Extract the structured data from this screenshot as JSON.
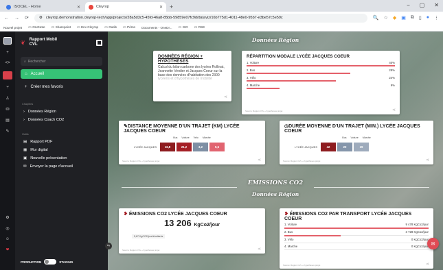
{
  "browser": {
    "tabs": [
      {
        "label": "ISOCEL - Home",
        "active": false,
        "color": "#3b78e7"
      },
      {
        "label": "Cleyrop",
        "active": true,
        "color": "#e8453c"
      }
    ],
    "url": "cleyrop.demonstration.cleyrop-tech/app/projects/28a5d3c5-45fd-46a8-85bb-59859e07fc9d/dataviz/16b775d1-4011-48e0-95b7-e3be57c5e59c",
    "bookmarks": [
      "Nouvel projet",
      "OneNote",
      "Sharepoint",
      "Env Cleyrop",
      "Outils",
      "Pérso",
      "Documents - OneDr...",
      "ISO",
      "RSE"
    ]
  },
  "sidebar": {
    "brand_line1": "Rapport Mobil",
    "brand_line2": "CVL",
    "search_placeholder": "Rechercher",
    "nav_home": "Accueil",
    "nav_create": "Créer mes favoris",
    "section_chapters": "Chapitres",
    "chapters": [
      "Données Région",
      "Données Coach CO2"
    ],
    "section_tools": "Outils",
    "tools": [
      "Rapport PDF",
      "Mur digital",
      "Nouvelle présentation",
      "Envoyer la page d'accueil"
    ],
    "env_left": "PRODUCTION",
    "env_right": "STAGING"
  },
  "main": {
    "section1_title": "Données Région",
    "section2_title": "EMISSIONS CO2",
    "section3_title": "Données Région",
    "card_hyp": {
      "title": "DONNÉES RÉGION + HYPOTHÈSES",
      "desc": "Calcul du bilan carbone des lycées Rollinat, Jeannette Verdier et Jacques Coeur sur la base des données d'habitation des 2300",
      "desc_faded": "lycéens et d'hypothèses de mobilité"
    },
    "card_rep": {
      "title": "RÉPARTITION MODALE LYCÉE JACQUES COEUR",
      "rows": [
        {
          "label": "1. Voiture",
          "value": "40%",
          "pct": 40
        },
        {
          "label": "2. Bus",
          "value": "28%",
          "pct": 28
        },
        {
          "label": "3. Vélo",
          "value": "24%",
          "pct": 24
        },
        {
          "label": "4. Marche",
          "value": "9%",
          "pct": 9
        }
      ],
      "source": "Source: Région CVL + hypothèses projet"
    },
    "card_dist": {
      "title": "DISTANCE MOYENNE D'UN TRAJET (KM) LYCÉE JACQUES COEUR",
      "legend": [
        "Bus",
        "Voiture",
        "Vélo",
        "Marche"
      ],
      "row_label": "LYCÉE JACQUES",
      "segments": [
        {
          "value": "16,8",
          "color": "#8e1c1f"
        },
        {
          "value": "21,2",
          "color": "#a51f26"
        },
        {
          "value": "3,2",
          "color": "#7e8fa4"
        },
        {
          "value": "5,5",
          "color": "#e16470"
        }
      ],
      "source": "Source: Région CVL + hypothèses projet"
    },
    "card_dur": {
      "title": "DURÉE MOYENNE D'UN TRAJET (MIN.) LYCÉE JACQUES COEUR",
      "legend": [
        "Bus",
        "Voiture",
        "Marche"
      ],
      "row_label": "LYCÉE JACQUES",
      "segments": [
        {
          "value": "42",
          "color": "#8e1c1f"
        },
        {
          "value": "20",
          "color": "#8596ab"
        },
        {
          "value": "19",
          "color": "#9eabbc"
        }
      ],
      "source": "Source: Région CVL + hypothèses projet"
    },
    "card_emis": {
      "title": "ÉMISSIONS CO2 LYCÉE JACQUES COEUR",
      "value": "13 206",
      "unit": "KgCo2/jour",
      "badge": "5,67 KgCO2/jour/étudiants",
      "source": "Source: Région CVL + hypothèses projet"
    },
    "card_trans": {
      "title": "ÉMISSIONS CO2 PAR TRANSPORT LYCÉE JACQUES COEUR",
      "rows": [
        {
          "label": "1. Voiture",
          "value": "9 478 KgCo2/jour",
          "pct": 100
        },
        {
          "label": "2. Bus",
          "value": "3 728 KgCo2/jour",
          "pct": 39
        },
        {
          "label": "3. Vélo",
          "value": "0 KgCo2/jour",
          "pct": 0
        },
        {
          "label": "4. Marche",
          "value": "0 KgCo2/jour",
          "pct": 0
        }
      ],
      "source": "Source: Région CVL + hypothèses projet"
    }
  }
}
